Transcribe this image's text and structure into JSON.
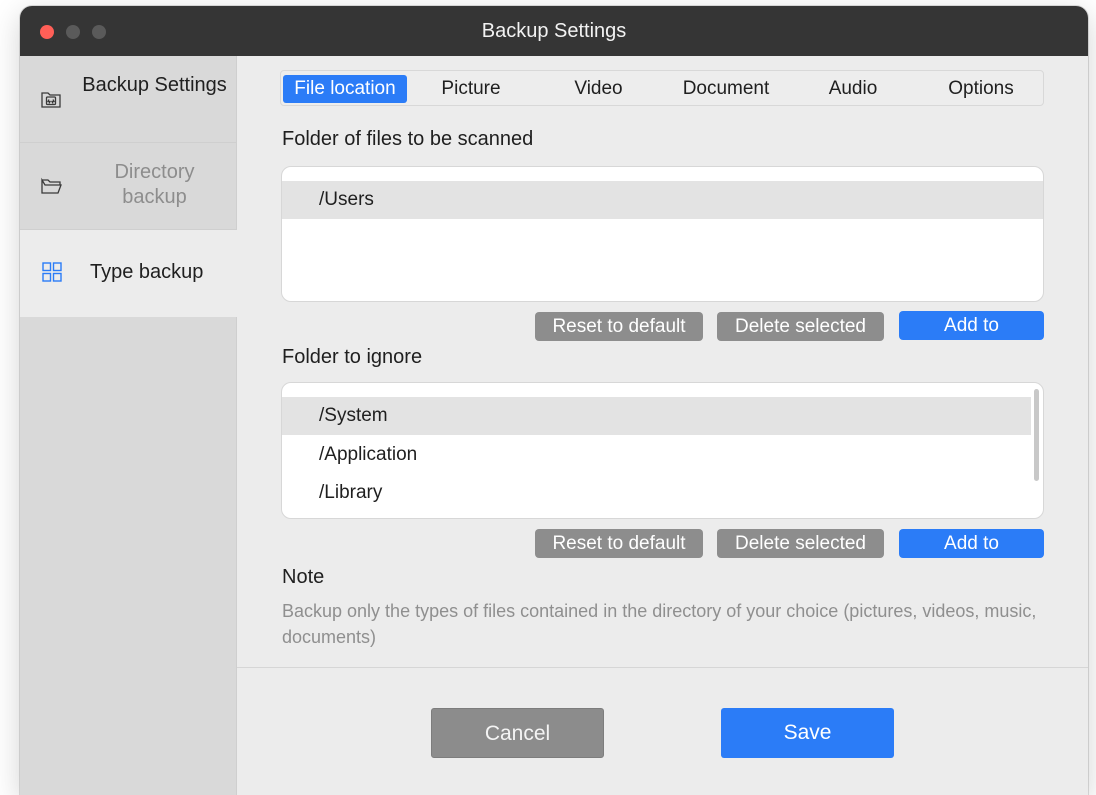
{
  "window": {
    "title": "Backup Settings"
  },
  "sidebar": {
    "items": [
      {
        "label": "Backup Settings",
        "icon": "backup-settings-icon",
        "state": "normal"
      },
      {
        "label": "Directory backup",
        "icon": "folder-icon",
        "state": "dimmed"
      },
      {
        "label": "Type backup",
        "icon": "grid-icon",
        "state": "selected"
      }
    ]
  },
  "tabs": [
    {
      "label": "File location",
      "active": true
    },
    {
      "label": "Picture",
      "active": false
    },
    {
      "label": "Video",
      "active": false
    },
    {
      "label": "Document",
      "active": false
    },
    {
      "label": "Audio",
      "active": false
    },
    {
      "label": "Options",
      "active": false
    }
  ],
  "scan_section": {
    "title": "Folder of files to be scanned",
    "folders": [
      "/Users"
    ],
    "selected": "/Users",
    "buttons": {
      "reset": "Reset to default",
      "delete": "Delete selected",
      "add": "Add to"
    }
  },
  "ignore_section": {
    "title": "Folder to ignore",
    "folders": [
      "/System",
      "/Application",
      "/Library"
    ],
    "selected": "/System",
    "buttons": {
      "reset": "Reset to default",
      "delete": "Delete selected",
      "add": "Add to"
    }
  },
  "note": {
    "title": "Note",
    "text": "Backup only the types of files contained in the directory of your choice (pictures, videos, music, documents)"
  },
  "footer": {
    "cancel": "Cancel",
    "save": "Save"
  },
  "colors": {
    "accent": "#2b7cf7",
    "titlebar": "#353535",
    "sidebar": "#d9d9d9",
    "content_bg": "#ececec",
    "secondary_button": "#8d8d8d",
    "close_dot": "#ff5f57"
  }
}
